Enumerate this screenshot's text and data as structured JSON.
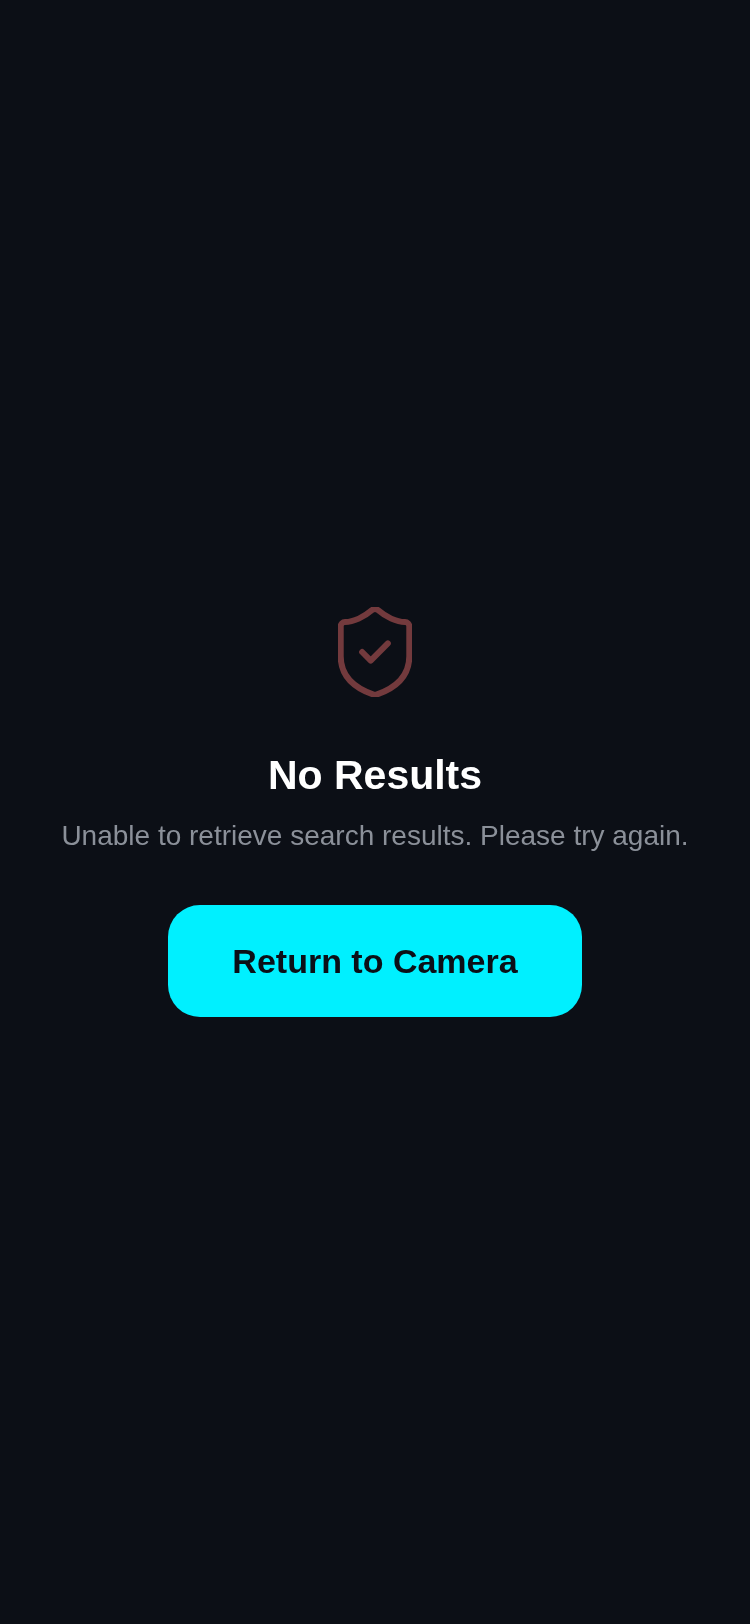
{
  "empty_state": {
    "title": "No Results",
    "message": "Unable to retrieve search results. Please try again."
  },
  "button": {
    "label": "Return to Camera"
  }
}
